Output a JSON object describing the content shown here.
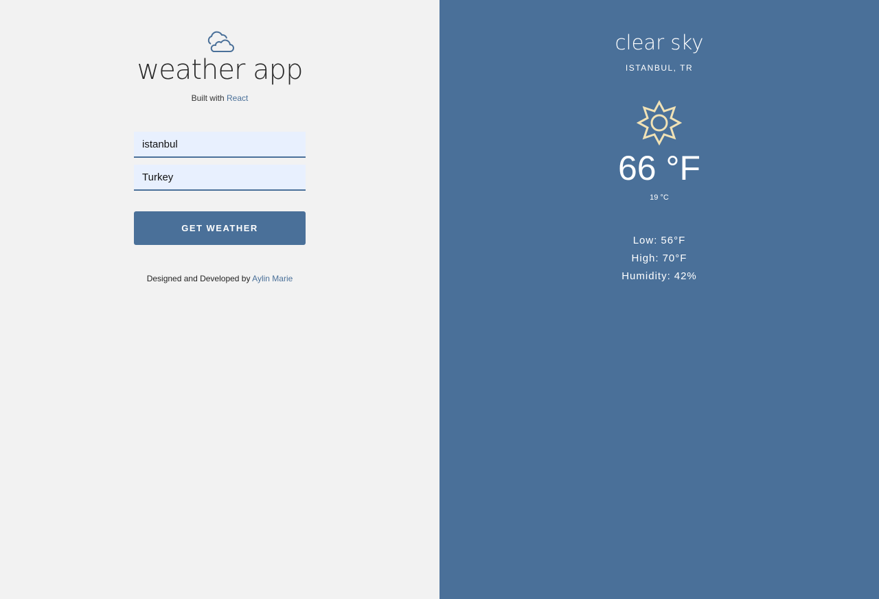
{
  "left": {
    "logo_icon": "cloud-icon",
    "title": "weather app",
    "built_with_text": "Built with",
    "built_with_link": "React",
    "city_value": "istanbul",
    "country_value": "Turkey",
    "button_label": "GET WEATHER",
    "credit_text": "Designed and Developed by",
    "credit_link": "Aylin Marie"
  },
  "right": {
    "condition": "clear sky",
    "location": "ISTANBUL, TR",
    "icon": "sun-icon",
    "temp_f": "66 °F",
    "temp_c": "19 °C",
    "low_label": "Low:",
    "low_value": "56°F",
    "high_label": "High:",
    "high_value": "70°F",
    "humidity_label": "Humidity:",
    "humidity_value": "42%"
  },
  "colors": {
    "accent": "#4a7099",
    "left_bg": "#f2f2f2",
    "input_bg": "#e8f0fe",
    "sun": "#f1e2b5"
  }
}
